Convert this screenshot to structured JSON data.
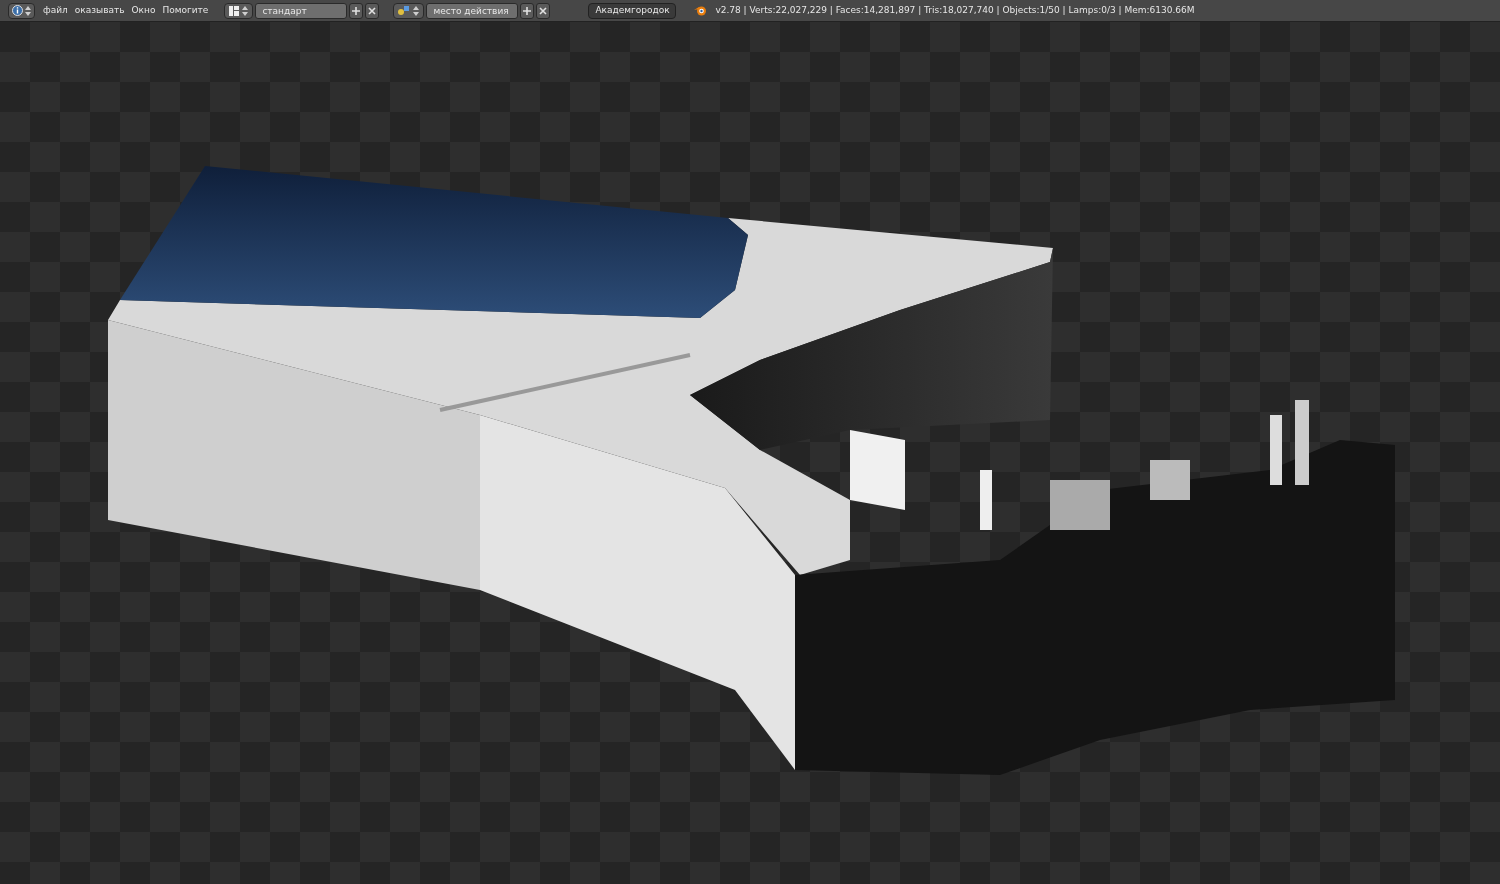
{
  "menu": [
    "файл",
    "оказывать",
    "Окно",
    "Помогите"
  ],
  "screen_layout": {
    "value": "стандарт"
  },
  "scene": {
    "value": "место действия"
  },
  "render_engine": {
    "value": "Академгородок"
  },
  "stats": "v2.78 | Verts:22,027,229 | Faces:14,281,897 | Tris:18,027,740 | Objects:1/50 | Lamps:0/3 | Mem:6130.66M"
}
